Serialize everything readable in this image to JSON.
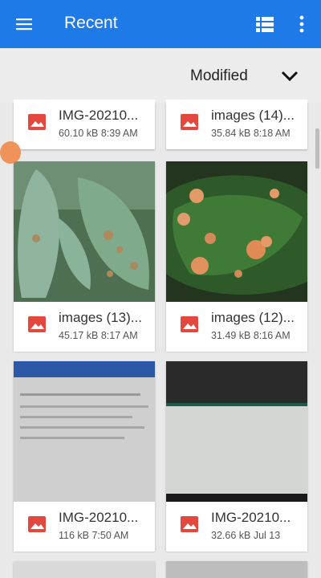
{
  "appbar": {
    "title": "Recent",
    "menu_icon": "menu-icon",
    "list_icon": "list-view-icon",
    "more_icon": "more-vert-icon",
    "color": "#1e7ae6"
  },
  "sort": {
    "label": "Modified",
    "icon": "chevron-down-icon"
  },
  "files": [
    {
      "name": "IMG-20210...",
      "meta": "60.10 kB 8:39 AM"
    },
    {
      "name": "images (14)...",
      "meta": "35.84 kB 8:18 AM"
    },
    {
      "name": "images (13)...",
      "meta": "45.17 kB 8:17 AM"
    },
    {
      "name": "images (12)...",
      "meta": "31.49 kB 8:16 AM"
    },
    {
      "name": "IMG-20210...",
      "meta": "116 kB 7:50 AM"
    },
    {
      "name": "IMG-20210...",
      "meta": "32.66 kB Jul 13"
    }
  ],
  "colors": {
    "image_icon": "#e2483d",
    "background": "#e9e9e9"
  }
}
